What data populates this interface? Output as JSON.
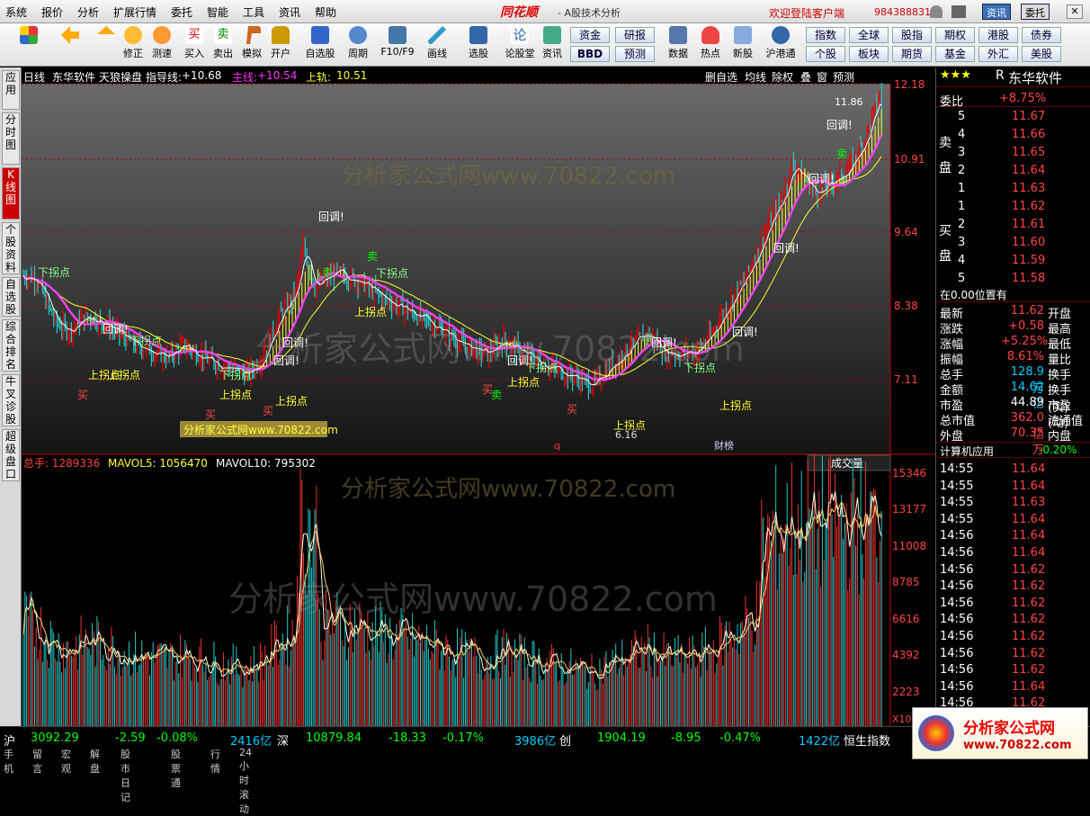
{
  "menubar": {
    "items": [
      "系统",
      "报价",
      "分析",
      "扩展行情",
      "委托",
      "智能",
      "工具",
      "资讯",
      "帮助"
    ],
    "brand": "同花顺",
    "title": "- A股技术分析",
    "welcome": "欢迎登陆客户端",
    "phone": "984388831",
    "btn_info": "资讯",
    "btn_trade": "委托"
  },
  "toolbar": {
    "buttons": [
      "修正",
      "测速",
      "买入",
      "卖出",
      "模拟",
      "开户",
      "自选股",
      "周期",
      "F10/F9",
      "画线",
      "选股",
      "论股堂",
      "资讯",
      "数据",
      "热点",
      "新股",
      "沪港通"
    ],
    "grid": [
      "资金",
      "研报",
      "指数",
      "全球",
      "股指",
      "期权",
      "港股",
      "债券",
      "BBD",
      "预测",
      "个股",
      "板块",
      "期货",
      "基金",
      "外汇",
      "美股"
    ]
  },
  "lefttabs": [
    "应用",
    "分时图",
    "K线图",
    "个股资料",
    "自选股",
    "综合排名",
    "牛叉诊股",
    "超级盘口"
  ],
  "kline": {
    "period": "日线",
    "name": "东华软件",
    "indicator": "天狼操盘",
    "guide_label": "指导线:",
    "guide_val": "+10.68",
    "main_label": "主线:",
    "main_val": "+10.54",
    "upper_label": "上轨:",
    "upper_val": "10.51",
    "buttons": [
      "删自选",
      "均线",
      "除权",
      "叠",
      "窗",
      "预测"
    ],
    "price_axis": [
      "12.18",
      "10.91",
      "9.64",
      "8.38",
      "7.11"
    ],
    "max_label": "11.86",
    "min_label": "6.16",
    "marker_q": "q",
    "marker_cb": "财榜"
  },
  "annotations": {
    "back": "回调!",
    "buy": "买",
    "sell": "卖",
    "up": "上拐点",
    "down": "下拐点"
  },
  "volume": {
    "total_label": "总手:",
    "total": "1289336",
    "ma5_label": "MAVOL5:",
    "ma5": "1056470",
    "ma10_label": "MAVOL10:",
    "ma10": "795302",
    "tab": "成交量",
    "axis": [
      "15346",
      "13177",
      "11008",
      "8785",
      "6616",
      "4392",
      "2223"
    ],
    "x10": "X10"
  },
  "watermark": "分析家公式网www.70822.com",
  "watermark2": "分析家公式网www.70822.com",
  "right": {
    "name": "东华软件",
    "rating": "★★★",
    "weibi_label": "委比",
    "weibi": "+8.75%",
    "sell_label": "卖盘",
    "buy_label": "买盘",
    "sells": [
      {
        "n": "5",
        "p": "11.67"
      },
      {
        "n": "4",
        "p": "11.66"
      },
      {
        "n": "3",
        "p": "11.65"
      },
      {
        "n": "2",
        "p": "11.64"
      },
      {
        "n": "1",
        "p": "11.63"
      }
    ],
    "buys": [
      {
        "n": "1",
        "p": "11.62"
      },
      {
        "n": "2",
        "p": "11.61"
      },
      {
        "n": "3",
        "p": "11.60"
      },
      {
        "n": "4",
        "p": "11.59"
      },
      {
        "n": "5",
        "p": "11.58"
      }
    ],
    "position": "在0.00位置有",
    "stats": [
      {
        "k": "最新",
        "v": "11.62",
        "k2": "开盘"
      },
      {
        "k": "涨跌",
        "v": "+0.58",
        "k2": "最高"
      },
      {
        "k": "涨幅",
        "v": "+5.25%",
        "k2": "最低"
      },
      {
        "k": "振幅",
        "v": "8.61%",
        "k2": "量比"
      },
      {
        "k": "总手",
        "v": "128.9万",
        "k2": "换手"
      },
      {
        "k": "金额",
        "v": "14.62亿",
        "k2": "换手(实)"
      },
      {
        "k": "市盈",
        "v": "44.89",
        "k2": "市盈(动)"
      },
      {
        "k": "总市值",
        "v": "362.0亿",
        "k2": "流通值"
      },
      {
        "k": "外盘",
        "v": "70.35万",
        "k2": "内盘"
      }
    ],
    "sector": "计算机应用",
    "sector_chg": "-0.20%",
    "ticks": [
      {
        "t": "14:55",
        "p": "11.64"
      },
      {
        "t": "14:55",
        "p": "11.64"
      },
      {
        "t": "14:55",
        "p": "11.63"
      },
      {
        "t": "14:55",
        "p": "11.64"
      },
      {
        "t": "14:56",
        "p": "11.64"
      },
      {
        "t": "14:56",
        "p": "11.64"
      },
      {
        "t": "14:56",
        "p": "11.62"
      },
      {
        "t": "14:56",
        "p": "11.62"
      },
      {
        "t": "14:56",
        "p": "11.62"
      },
      {
        "t": "14:56",
        "p": "11.62"
      },
      {
        "t": "14:56",
        "p": "11.62"
      },
      {
        "t": "14:56",
        "p": "11.62"
      },
      {
        "t": "14:56",
        "p": "11.62"
      },
      {
        "t": "14:56",
        "p": "11.64"
      },
      {
        "t": "14:56",
        "p": "11.62"
      }
    ]
  },
  "status": {
    "sh_label": "沪",
    "sh": "3092.29",
    "sh_chg": "-2.59",
    "sh_pct": "-0.08%",
    "sh_amt": "2416亿",
    "sz_label": "深",
    "sz": "10879.84",
    "sz_chg": "-18.33",
    "sz_pct": "-0.17%",
    "sz_amt": "3986亿",
    "cy_label": "创",
    "cy": "1904.19",
    "cy_chg": "-8.95",
    "cy_pct": "-0.47%",
    "cy_amt": "1422亿",
    "hs_label": "恒生指数"
  },
  "bottomtabs": [
    "手机",
    "留言",
    "宏观",
    "解盘",
    "股市日记",
    "股票通",
    "行情",
    "24小时滚动"
  ],
  "logo": {
    "text": "分析家公式网",
    "url": "www.70822.com"
  }
}
